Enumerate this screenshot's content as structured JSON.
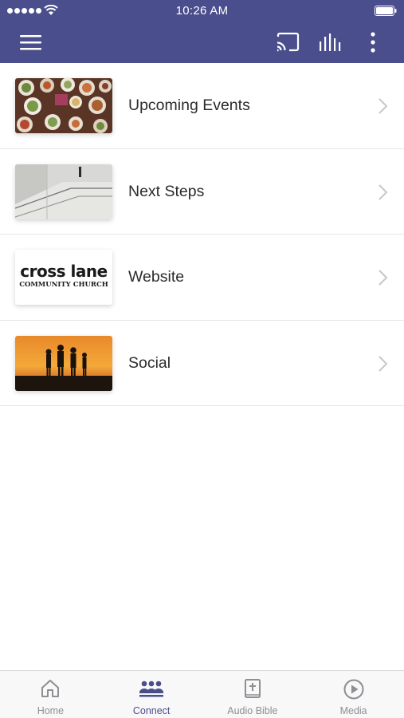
{
  "status_bar": {
    "time": "10:26 AM"
  },
  "toolbar": {
    "menu_icon": "hamburger-menu-icon",
    "cast_icon": "cast-icon",
    "audio_icon": "audio-bars-icon",
    "more_icon": "more-vertical-icon"
  },
  "colors": {
    "header": "#4a4e8c",
    "active_tab": "#4a4e8c",
    "inactive_tab": "#8e8e93"
  },
  "list": {
    "items": [
      {
        "label": "Upcoming Events",
        "thumbnail": "food-table-photo"
      },
      {
        "label": "Next Steps",
        "thumbnail": "staircase-photo"
      },
      {
        "label": "Website",
        "thumbnail": "cross-lane-logo",
        "logo_text": "cross lane",
        "logo_subtext": "COMMUNITY CHURCH"
      },
      {
        "label": "Social",
        "thumbnail": "sunset-family-photo"
      }
    ]
  },
  "tab_bar": {
    "tabs": [
      {
        "label": "Home",
        "icon": "home-icon",
        "active": false
      },
      {
        "label": "Connect",
        "icon": "people-icon",
        "active": true
      },
      {
        "label": "Audio Bible",
        "icon": "bible-icon",
        "active": false
      },
      {
        "label": "Media",
        "icon": "play-circle-icon",
        "active": false
      }
    ]
  }
}
